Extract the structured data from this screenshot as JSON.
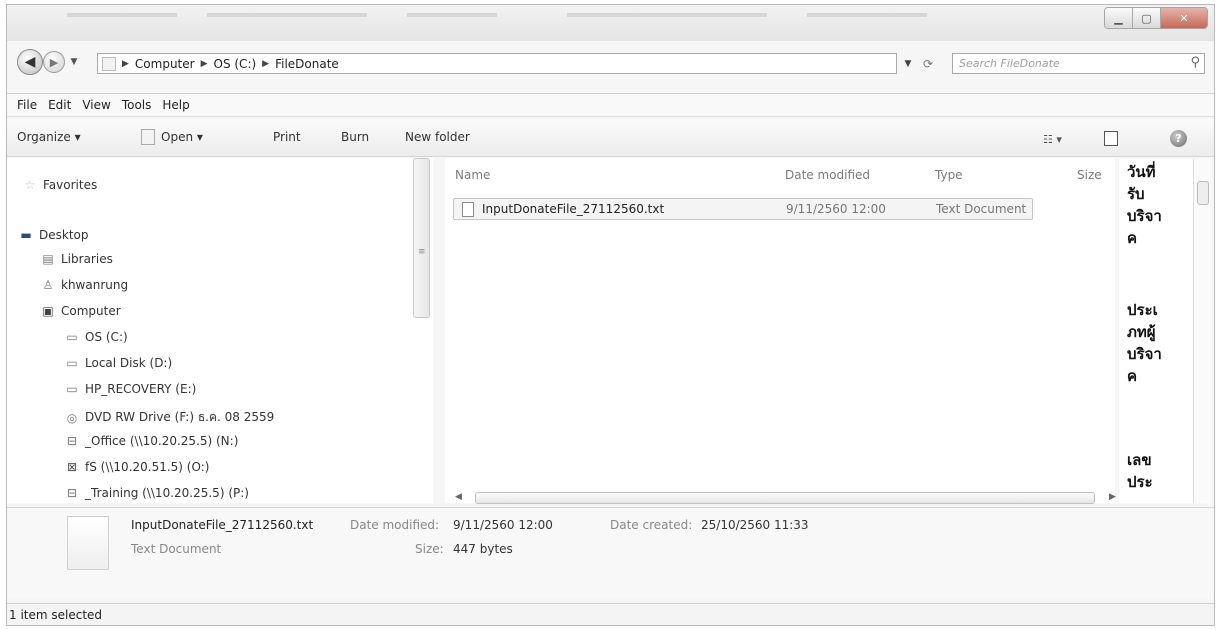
{
  "address": {
    "breadcrumb": [
      "Computer",
      "OS (C:)",
      "FileDonate"
    ],
    "search_placeholder": "Search FileDonate"
  },
  "menu": [
    "File",
    "Edit",
    "View",
    "Tools",
    "Help"
  ],
  "toolbar": {
    "organize": "Organize ▾",
    "open": "Open ▾",
    "print": "Print",
    "burn": "Burn",
    "new_folder": "New folder"
  },
  "nav": {
    "favorites": "Favorites",
    "desktop": "Desktop",
    "libraries": "Libraries",
    "user": "khwanrung",
    "computer": "Computer",
    "drives": [
      "OS (C:)",
      "Local Disk (D:)",
      "HP_RECOVERY (E:)",
      "DVD RW Drive (F:) ธ.ค. 08 2559",
      "_Office (\\\\10.20.25.5) (N:)",
      "fS (\\\\10.20.51.5) (O:)",
      "_Training (\\\\10.20.25.5) (P:)"
    ]
  },
  "file_list": {
    "columns": [
      "Name",
      "Date modified",
      "Type",
      "Size"
    ],
    "rows": [
      {
        "name": "InputDonateFile_27112560.txt",
        "date_modified": "9/11/2560 12:00",
        "type": "Text Document"
      }
    ]
  },
  "thai_column": [
    "วันที่",
    "รับ",
    "บริจา",
    "ค",
    "ประเ",
    "ภทผู้",
    "บริจา",
    "ค",
    "เลข",
    "ประ"
  ],
  "details": {
    "filename": "InputDonateFile_27112560.txt",
    "type": "Text Document",
    "date_modified_label": "Date modified:",
    "date_modified": "9/11/2560 12:00",
    "size_label": "Size:",
    "size": "447 bytes",
    "date_created_label": "Date created:",
    "date_created": "25/10/2560 11:33"
  },
  "status": "1 item selected"
}
